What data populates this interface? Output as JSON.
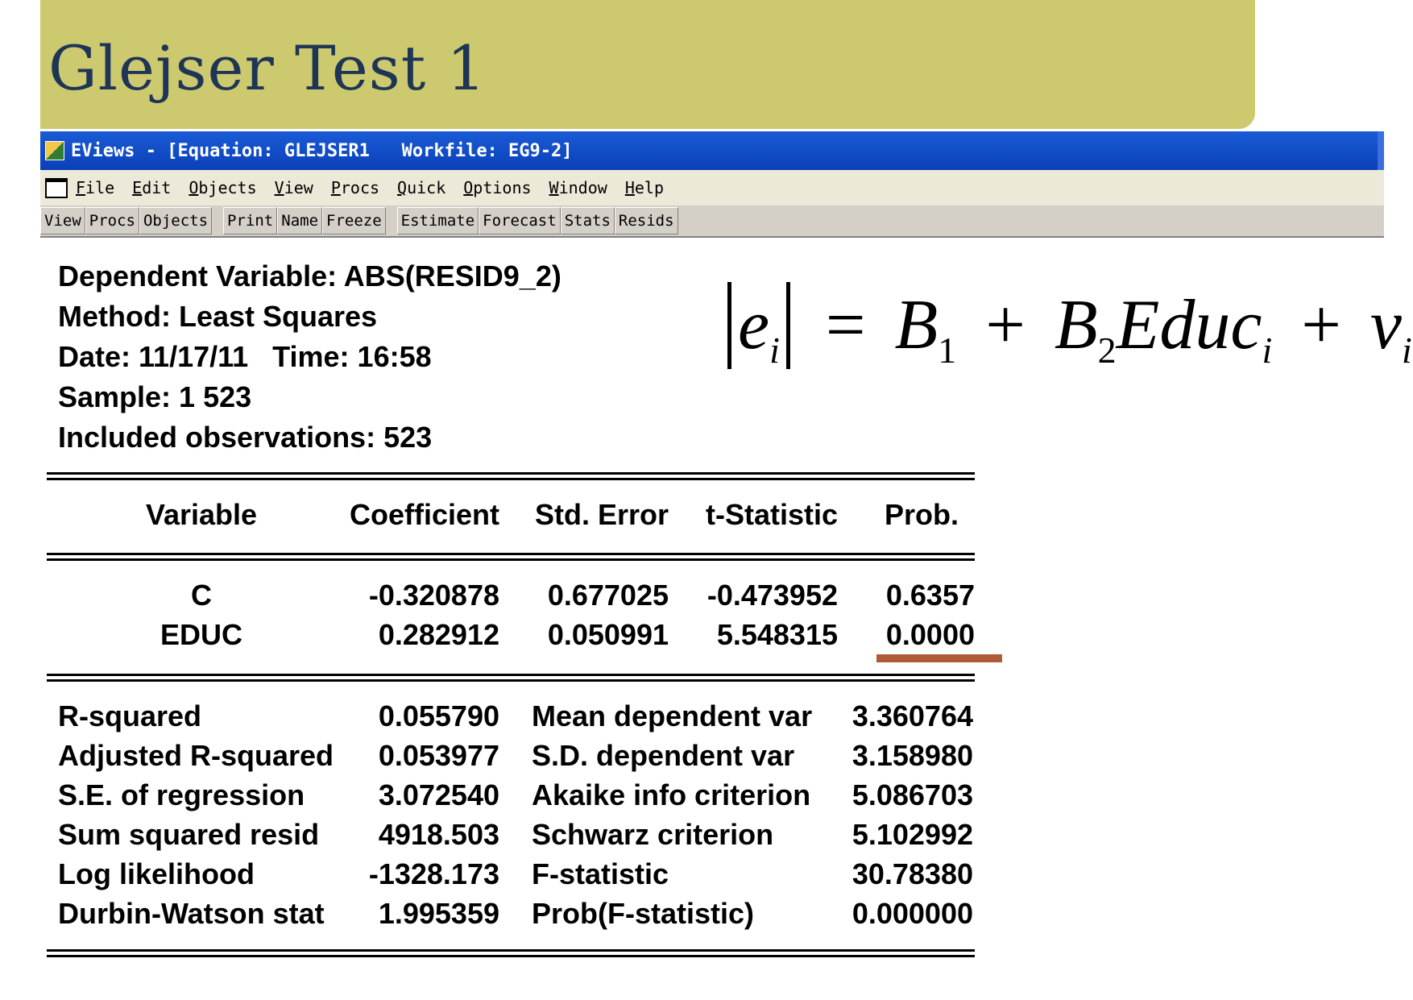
{
  "slide": {
    "title": "Glejser Test 1"
  },
  "window": {
    "title": "EViews - [Equation: GLEJSER1   Workfile: EG9-2]",
    "menu": [
      "File",
      "Edit",
      "Objects",
      "View",
      "Procs",
      "Quick",
      "Options",
      "Window",
      "Help"
    ],
    "toolbar": [
      "View",
      "Procs",
      "Objects",
      "Print",
      "Name",
      "Freeze",
      "Estimate",
      "Forecast",
      "Stats",
      "Resids"
    ]
  },
  "header": {
    "dependent": "Dependent Variable: ABS(RESID9_2)",
    "method": "Method: Least Squares",
    "date": "Date: 11/17/11   Time: 16:58",
    "sample": "Sample: 1 523",
    "included": "Included observations: 523"
  },
  "formula": {
    "lhs_var": "e",
    "lhs_sub": "i",
    "eq": "=",
    "b1": "B",
    "b1_sub": "1",
    "plus1": "+",
    "b2": "B",
    "b2_sub": "2",
    "term": "Educ",
    "term_sub": "i",
    "plus2": "+",
    "v": "v",
    "v_sub": "i"
  },
  "coef_table": {
    "headers": [
      "Variable",
      "Coefficient",
      "Std. Error",
      "t-Statistic",
      "Prob."
    ],
    "rows": [
      [
        "C",
        "-0.320878",
        "0.677025",
        "-0.473952",
        "0.6357"
      ],
      [
        "EDUC",
        "0.282912",
        "0.050991",
        "5.548315",
        "0.0000"
      ]
    ]
  },
  "stats": {
    "rows": [
      [
        "R-squared",
        "0.055790",
        "Mean dependent var",
        "3.360764"
      ],
      [
        "Adjusted R-squared",
        "0.053977",
        "S.D. dependent var",
        "3.158980"
      ],
      [
        "S.E. of regression",
        "3.072540",
        "Akaike info criterion",
        "5.086703"
      ],
      [
        "Sum squared resid",
        "4918.503",
        "Schwarz criterion",
        "5.102992"
      ],
      [
        "Log likelihood",
        "-1328.173",
        "F-statistic",
        "30.78380"
      ],
      [
        "Durbin-Watson stat",
        "1.995359",
        "Prob(F-statistic)",
        "0.000000"
      ]
    ]
  },
  "colors": {
    "banner": "#cdc96e",
    "title_text": "#1f3557",
    "highlight": "#b05a37"
  }
}
